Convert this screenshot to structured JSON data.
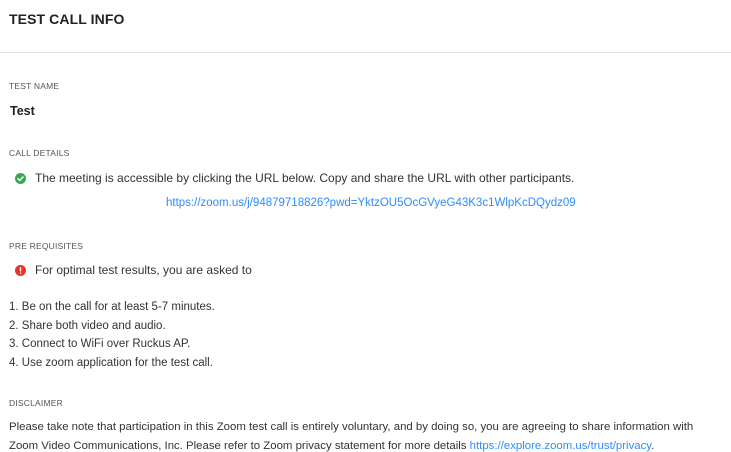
{
  "header": {
    "title": "TEST CALL INFO"
  },
  "test_name": {
    "label": "TEST NAME",
    "value": "Test"
  },
  "call_details": {
    "label": "CALL DETAILS",
    "status_icon": "check-circle-icon",
    "status_color": "#3aa757",
    "message": "The meeting is accessible by clicking the URL below. Copy and share the URL with other participants.",
    "meeting_url": "https://zoom.us/j/94879718826?pwd=YktzOU5OcGVyeG43K3c1WlpKcDQydz09"
  },
  "prerequisites": {
    "label": "PRE REQUISITES",
    "alert_icon": "alert-circle-icon",
    "alert_color": "#e8332c",
    "intro": "For optimal test results, you are asked to",
    "steps": [
      "1. Be on the call for at least 5-7 minutes.",
      "2. Share both video and audio.",
      "3. Connect to WiFi over Ruckus AP.",
      "4. Use zoom application for the test call."
    ]
  },
  "disclaimer": {
    "label": "DISCLAIMER",
    "line1": "Please take note that participation in this Zoom test call is entirely voluntary, and by doing so, you are agreeing to share information with",
    "line2": "Zoom Video Communications, Inc. Please refer to Zoom privacy statement for more details ",
    "link": "https://explore.zoom.us/trust/privacy",
    "line2_end": "."
  },
  "colors": {
    "link": "#2d8cff",
    "divider": "#e4e4e4"
  }
}
